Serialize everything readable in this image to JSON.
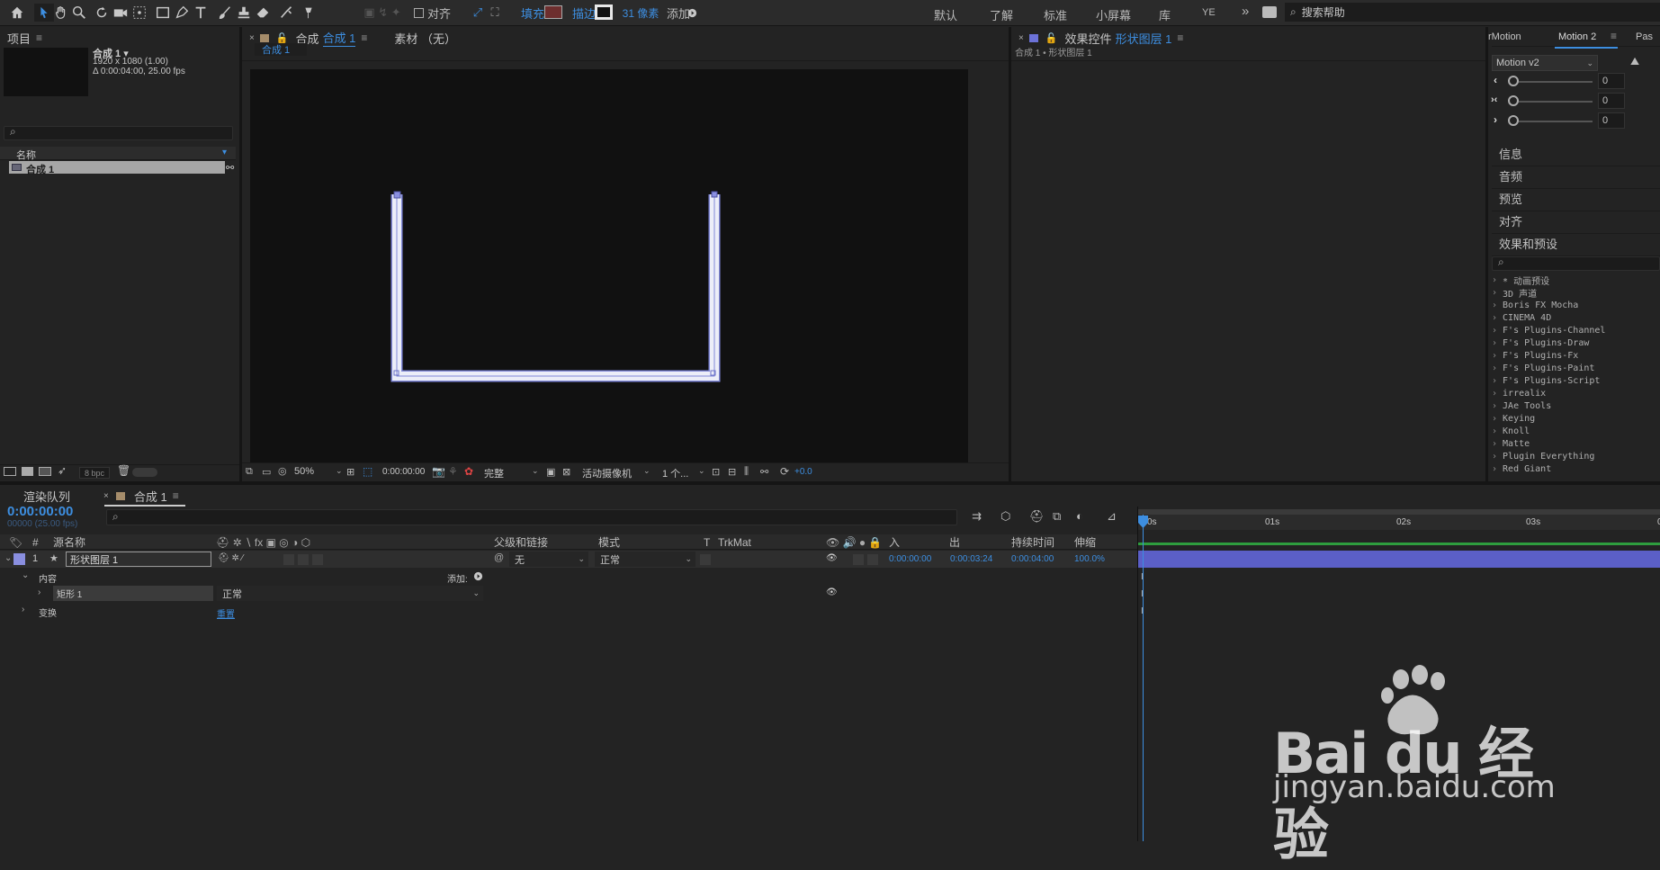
{
  "toolbar": {
    "align_label": "对齐",
    "fill_label": "填充",
    "stroke_label": "描边",
    "stroke_px": "31 像素",
    "add_label": "添加",
    "workspaces": [
      "默认",
      "了解",
      "标准",
      "小屏幕",
      "库"
    ],
    "ye_label": "YE",
    "search_placeholder": "搜索帮助"
  },
  "project": {
    "title": "项目",
    "comp_name": "合成 1 ▾",
    "comp_res": "1920 x 1080 (1.00)",
    "comp_dur": "Δ 0:00:04:00, 25.00 fps",
    "col_name": "名称",
    "item_name": "合成 1",
    "bpc": "8 bpc"
  },
  "comp_panel": {
    "tab_prefix": "合成",
    "tab_name": "合成 1",
    "footage_tab": "素材 （无）",
    "sub_tab": "合成 1",
    "zoom": "50%",
    "timecode": "0:00:00:00",
    "quality": "完整",
    "camera": "活动摄像机",
    "views": "1 个...",
    "exposure": "+0.0"
  },
  "effects_panel": {
    "title": "效果控件",
    "layer": "形状图层 1",
    "breadcrumb": "合成 1 • 形状图层 1"
  },
  "right_panel": {
    "tab1": "rMotion",
    "tab2": "Motion 2",
    "tab3": "Pas",
    "dropdown": "Motion v2",
    "slider_values": [
      "0",
      "0",
      "0"
    ],
    "sections": [
      "信息",
      "音频",
      "预览",
      "对齐",
      "效果和预设"
    ],
    "effects_list": [
      "* 动画预设",
      "3D 声道",
      "Boris FX Mocha",
      "CINEMA 4D",
      "F's Plugins-Channel",
      "F's Plugins-Draw",
      "F's Plugins-Fx",
      "F's Plugins-Paint",
      "F's Plugins-Script",
      "irrealix",
      "JAe Tools",
      "Keying",
      "Knoll",
      "Matte",
      "Plugin Everything",
      "Red Giant"
    ]
  },
  "timeline": {
    "render_tab": "渲染队列",
    "comp_tab": "合成 1",
    "timecode": "0:00:00:00",
    "frames": "00000 (25.00 fps)",
    "cols": {
      "source": "源名称",
      "parent": "父级和链接",
      "mode": "模式",
      "t": "T",
      "trkmat": "TrkMat",
      "in": "入",
      "out": "出",
      "duration": "持续时间",
      "stretch": "伸缩"
    },
    "layer": {
      "num": "1",
      "name": "形状图层 1",
      "parent": "无",
      "mode": "正常",
      "in": "0:00:00:00",
      "out": "0:00:03:24",
      "duration": "0:00:04:00",
      "stretch": "100.0%"
    },
    "contents": "内容",
    "add": "添加:",
    "rect": "矩形 1",
    "rect_mode": "正常",
    "transform": "变换",
    "reset": "重置",
    "ruler": [
      "0s",
      "01s",
      "02s",
      "03s"
    ]
  },
  "watermark": {
    "brand": "Bai du 经验",
    "url": "jingyan.baidu.com"
  },
  "colors": {
    "accent": "#3d8ee0",
    "layer_bar": "#5b5fc7",
    "label_purple": "#8a8fe0"
  }
}
